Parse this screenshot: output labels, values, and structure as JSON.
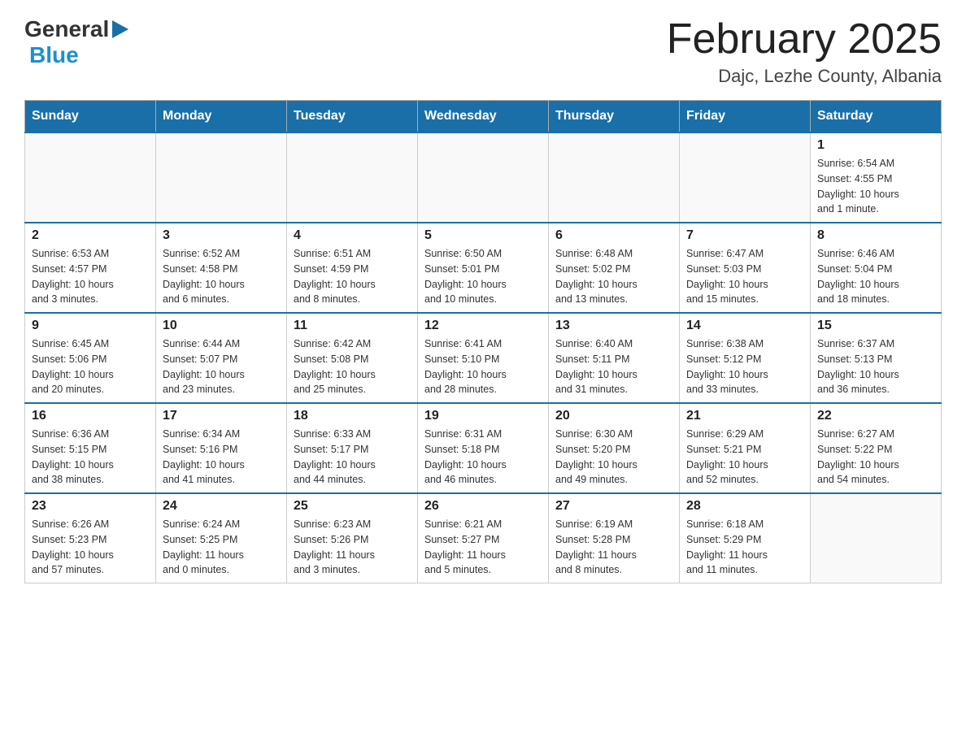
{
  "header": {
    "logo_general": "General",
    "logo_blue": "Blue",
    "title": "February 2025",
    "subtitle": "Dajc, Lezhe County, Albania"
  },
  "weekdays": [
    "Sunday",
    "Monday",
    "Tuesday",
    "Wednesday",
    "Thursday",
    "Friday",
    "Saturday"
  ],
  "weeks": [
    [
      {
        "day": "",
        "info": ""
      },
      {
        "day": "",
        "info": ""
      },
      {
        "day": "",
        "info": ""
      },
      {
        "day": "",
        "info": ""
      },
      {
        "day": "",
        "info": ""
      },
      {
        "day": "",
        "info": ""
      },
      {
        "day": "1",
        "info": "Sunrise: 6:54 AM\nSunset: 4:55 PM\nDaylight: 10 hours\nand 1 minute."
      }
    ],
    [
      {
        "day": "2",
        "info": "Sunrise: 6:53 AM\nSunset: 4:57 PM\nDaylight: 10 hours\nand 3 minutes."
      },
      {
        "day": "3",
        "info": "Sunrise: 6:52 AM\nSunset: 4:58 PM\nDaylight: 10 hours\nand 6 minutes."
      },
      {
        "day": "4",
        "info": "Sunrise: 6:51 AM\nSunset: 4:59 PM\nDaylight: 10 hours\nand 8 minutes."
      },
      {
        "day": "5",
        "info": "Sunrise: 6:50 AM\nSunset: 5:01 PM\nDaylight: 10 hours\nand 10 minutes."
      },
      {
        "day": "6",
        "info": "Sunrise: 6:48 AM\nSunset: 5:02 PM\nDaylight: 10 hours\nand 13 minutes."
      },
      {
        "day": "7",
        "info": "Sunrise: 6:47 AM\nSunset: 5:03 PM\nDaylight: 10 hours\nand 15 minutes."
      },
      {
        "day": "8",
        "info": "Sunrise: 6:46 AM\nSunset: 5:04 PM\nDaylight: 10 hours\nand 18 minutes."
      }
    ],
    [
      {
        "day": "9",
        "info": "Sunrise: 6:45 AM\nSunset: 5:06 PM\nDaylight: 10 hours\nand 20 minutes."
      },
      {
        "day": "10",
        "info": "Sunrise: 6:44 AM\nSunset: 5:07 PM\nDaylight: 10 hours\nand 23 minutes."
      },
      {
        "day": "11",
        "info": "Sunrise: 6:42 AM\nSunset: 5:08 PM\nDaylight: 10 hours\nand 25 minutes."
      },
      {
        "day": "12",
        "info": "Sunrise: 6:41 AM\nSunset: 5:10 PM\nDaylight: 10 hours\nand 28 minutes."
      },
      {
        "day": "13",
        "info": "Sunrise: 6:40 AM\nSunset: 5:11 PM\nDaylight: 10 hours\nand 31 minutes."
      },
      {
        "day": "14",
        "info": "Sunrise: 6:38 AM\nSunset: 5:12 PM\nDaylight: 10 hours\nand 33 minutes."
      },
      {
        "day": "15",
        "info": "Sunrise: 6:37 AM\nSunset: 5:13 PM\nDaylight: 10 hours\nand 36 minutes."
      }
    ],
    [
      {
        "day": "16",
        "info": "Sunrise: 6:36 AM\nSunset: 5:15 PM\nDaylight: 10 hours\nand 38 minutes."
      },
      {
        "day": "17",
        "info": "Sunrise: 6:34 AM\nSunset: 5:16 PM\nDaylight: 10 hours\nand 41 minutes."
      },
      {
        "day": "18",
        "info": "Sunrise: 6:33 AM\nSunset: 5:17 PM\nDaylight: 10 hours\nand 44 minutes."
      },
      {
        "day": "19",
        "info": "Sunrise: 6:31 AM\nSunset: 5:18 PM\nDaylight: 10 hours\nand 46 minutes."
      },
      {
        "day": "20",
        "info": "Sunrise: 6:30 AM\nSunset: 5:20 PM\nDaylight: 10 hours\nand 49 minutes."
      },
      {
        "day": "21",
        "info": "Sunrise: 6:29 AM\nSunset: 5:21 PM\nDaylight: 10 hours\nand 52 minutes."
      },
      {
        "day": "22",
        "info": "Sunrise: 6:27 AM\nSunset: 5:22 PM\nDaylight: 10 hours\nand 54 minutes."
      }
    ],
    [
      {
        "day": "23",
        "info": "Sunrise: 6:26 AM\nSunset: 5:23 PM\nDaylight: 10 hours\nand 57 minutes."
      },
      {
        "day": "24",
        "info": "Sunrise: 6:24 AM\nSunset: 5:25 PM\nDaylight: 11 hours\nand 0 minutes."
      },
      {
        "day": "25",
        "info": "Sunrise: 6:23 AM\nSunset: 5:26 PM\nDaylight: 11 hours\nand 3 minutes."
      },
      {
        "day": "26",
        "info": "Sunrise: 6:21 AM\nSunset: 5:27 PM\nDaylight: 11 hours\nand 5 minutes."
      },
      {
        "day": "27",
        "info": "Sunrise: 6:19 AM\nSunset: 5:28 PM\nDaylight: 11 hours\nand 8 minutes."
      },
      {
        "day": "28",
        "info": "Sunrise: 6:18 AM\nSunset: 5:29 PM\nDaylight: 11 hours\nand 11 minutes."
      },
      {
        "day": "",
        "info": ""
      }
    ]
  ]
}
